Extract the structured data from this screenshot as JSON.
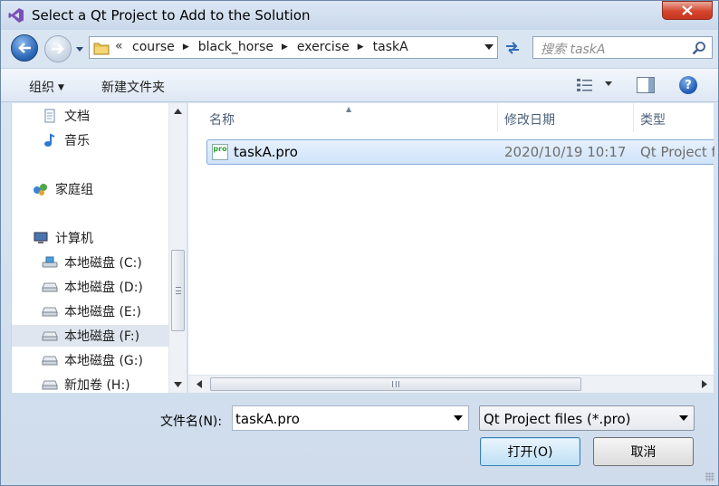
{
  "window": {
    "title": "Select a Qt Project to Add to the Solution"
  },
  "address": {
    "overflow": "«",
    "crumbs": [
      "course",
      "black_horse",
      "exercise",
      "taskA"
    ]
  },
  "search": {
    "placeholder": "搜索 taskA"
  },
  "toolbar": {
    "organize_label": "组织",
    "new_folder_label": "新建文件夹",
    "help_label": "?"
  },
  "nav_pane": {
    "items": [
      {
        "label": "文档",
        "icon": "documents-icon"
      },
      {
        "label": "音乐",
        "icon": "music-icon"
      },
      {
        "label": "家庭组",
        "icon": "homegroup-icon"
      },
      {
        "label": "计算机",
        "icon": "computer-icon"
      },
      {
        "label": "本地磁盘 (C:)",
        "icon": "system-drive-icon"
      },
      {
        "label": "本地磁盘 (D:)",
        "icon": "drive-icon"
      },
      {
        "label": "本地磁盘 (E:)",
        "icon": "drive-icon"
      },
      {
        "label": "本地磁盘 (F:)",
        "icon": "drive-icon",
        "selected": true
      },
      {
        "label": "本地磁盘 (G:)",
        "icon": "drive-icon"
      },
      {
        "label": "新加卷 (H:)",
        "icon": "drive-icon"
      }
    ]
  },
  "file_list": {
    "columns": [
      "名称",
      "修改日期",
      "类型"
    ],
    "rows": [
      {
        "icon_text": "pro",
        "name": "taskA.pro",
        "modified": "2020/10/19 10:17",
        "type": "Qt Project f"
      }
    ]
  },
  "filename": {
    "label": "文件名(N):",
    "value": "taskA.pro"
  },
  "filetype": {
    "value": "Qt Project files (*.pro)"
  },
  "buttons": {
    "open": "打开(O)",
    "cancel": "取消"
  },
  "colors": {
    "selection": "#cfe3fa",
    "close": "#d5452d",
    "accent": "#2a67b5"
  }
}
